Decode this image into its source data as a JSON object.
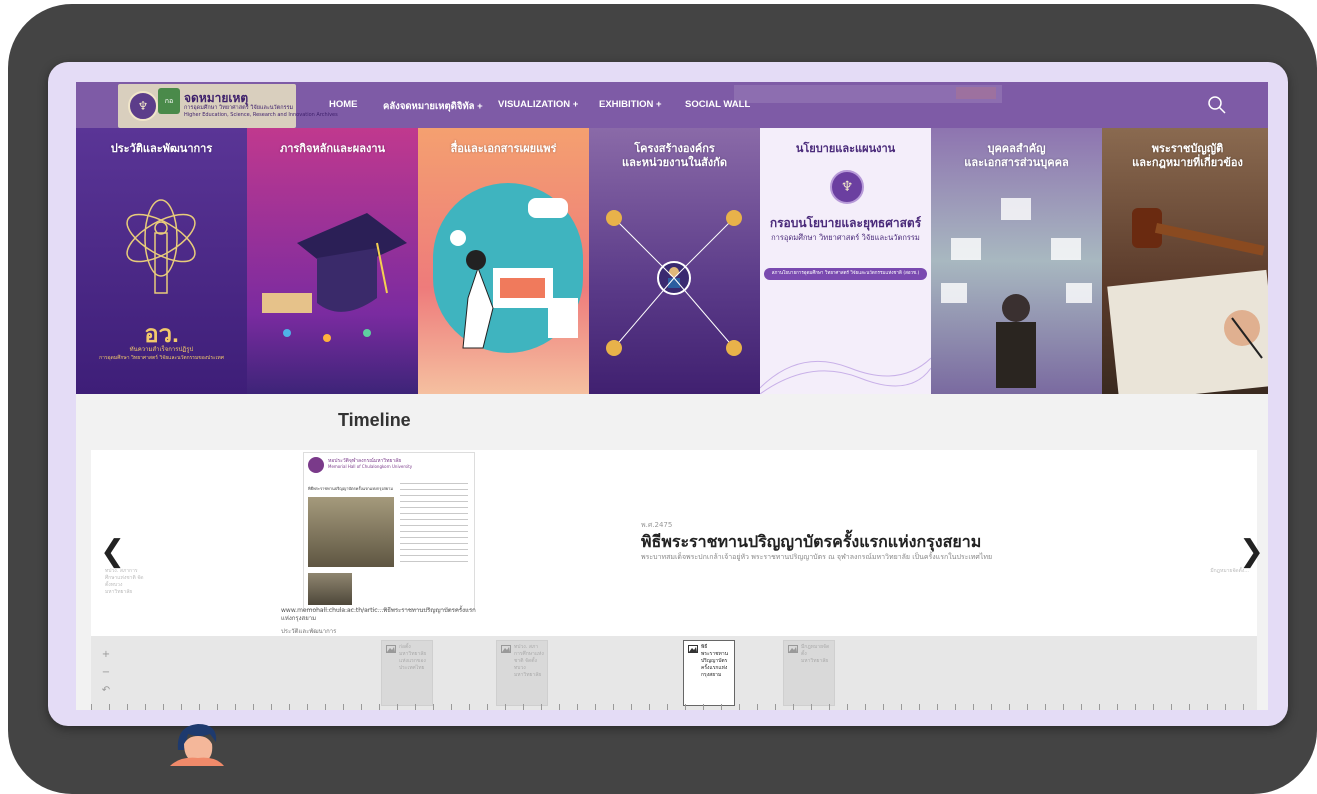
{
  "brand": {
    "logo_title": "จดหมายเหตุ",
    "logo_sub_th": "การอุดมศึกษา วิทยาศาสตร์ วิจัยและนวัตกรรม",
    "logo_sub_en": "Higher Education, Science, Research and Innovation Archives",
    "seal_text": "กอ"
  },
  "nav": {
    "items": [
      "HOME",
      "คลังจดหมายเหตุดิจิทัล +",
      "VISUALIZATION +",
      "EXHIBITION +",
      "SOCIAL WALL"
    ],
    "search_icon": "search-icon"
  },
  "cards": [
    {
      "title": "ประวัติและพัฒนาการ",
      "overlay_logo": "อว.",
      "overlay_line1": "ทันความสำเร็จการปฏิรูป",
      "overlay_line2": "การอุดมศึกษา วิทยาศาสตร์ วิจัยและนวัตกรรมของประเทศ",
      "bg": "#4c2a86"
    },
    {
      "title": "ภารกิจหลักและผลงาน",
      "bg": "#b8328f"
    },
    {
      "title": "สื่อและเอกสารเผยแพร่",
      "bg": "#f28a6c"
    },
    {
      "title": "โครงสร้างองค์กร\nและหน่วยงานในสังกัด",
      "bg": "#5b3a8a"
    },
    {
      "title": "นโยบายและแผนงาน",
      "subtitle": "กรอบนโยบายและยุทธศาสตร์",
      "subtitle2": "การอุดมศึกษา วิทยาศาสตร์ วิจัยและนวัตกรรม",
      "badge": "สภานโยบายการอุดมศึกษา วิทยาศาสตร์ วิจัยและนวัตกรรมแห่งชาติ (สอวช.)",
      "bg": "#f3eef9"
    },
    {
      "title": "บุคคลสำคัญ\nและเอกสารส่วนบุคคล",
      "bg": "#8f88ae"
    },
    {
      "title": "พระราชบัญญัติ\nและกฎหมายที่เกี่ยวข้อง",
      "bg": "#6a4a3a"
    }
  ],
  "timeline": {
    "heading": "Timeline",
    "slide": {
      "date": "พ.ศ.2475",
      "title": "พิธีพระราชทานปริญญาบัตรครั้งแรกแห่งกรุงสยาม",
      "text": "พระบาทสมเด็จพระปกเกล้าเจ้าอยู่หัว พระราชทานปริญญาบัตร ณ จุฬาลงกรณ์มหาวิทยาลัย เป็นครั้งแรกในประเทศไทย",
      "media_caption": "www.memohall.chula.ac.th/artic...พิธีพระราชทานปริญญาบัตรครั้งแรกแห่งกรุงสยาม",
      "media_credit": "ประวัติและพัฒนาการ",
      "media_header": "หอประวัติจุฬาลงกรณ์มหาวิทยาลัย",
      "media_header_en": "Memorial Hall of Chulalongkorn University",
      "media_article_title": "พิธีพระราชทานปริญญาบัตรครั้งแรกแห่งกรุงสยาม"
    },
    "prev_label": "ทปวง. สภาการศึกษาแห่งชาติ จัดตั้งทบวงมหาวิทยาลัย",
    "next_label": "มีกฎหมายจัดตั้ง...",
    "markers": [
      {
        "text": "ก่อตั้งมหาวิทยาลัยแห่งแรกของประเทศไทย"
      },
      {
        "text": "ทปวง. สภาการศึกษาแห่งชาติ จัดตั้งทบวงมหาวิทยาลัย"
      },
      {
        "text": "พิธีพระราชทานปริญญาบัตรครั้งแรกแห่งกรุงสยาม"
      },
      {
        "text": "มีกฎหมายจัดตั้งมหาวิทยาลัย"
      }
    ],
    "zoom_in": "+",
    "zoom_out": "−",
    "back": "↶"
  }
}
